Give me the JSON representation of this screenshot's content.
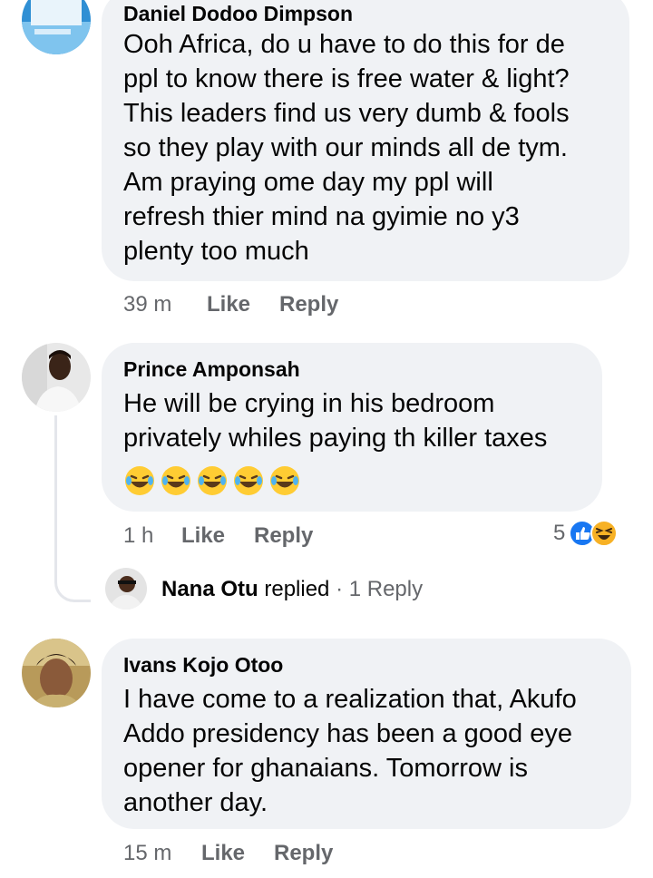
{
  "comments": [
    {
      "author": "Daniel Dodoo Dimpson",
      "lines": [
        "Ooh Africa, do u have to do this for de",
        "ppl to know there is free water & light?",
        "This leaders find us very dumb & fools",
        "so they play with our minds all de tym.",
        "Am praying ome day my ppl will",
        "refresh thier mind na gyimie no y3",
        "plenty too much"
      ],
      "time": "39 m",
      "like": "Like",
      "reply": "Reply"
    },
    {
      "author": "Prince Amponsah",
      "lines": [
        "He will be crying in his bedroom",
        "privately whiles paying th killer taxes"
      ],
      "emoji": [
        "laughing-tears",
        "laughing-tears",
        "laughing-tears",
        "laughing-tears",
        "laughing-tears"
      ],
      "time": "1 h",
      "like": "Like",
      "reply": "Reply",
      "reaction_count": "5",
      "reaction_icons": [
        "like-reaction-icon",
        "haha-reaction-icon"
      ],
      "replies": {
        "name": "Nana Otu",
        "verb": " replied",
        "separator": " · ",
        "count": "1 Reply"
      }
    },
    {
      "author": "Ivans Kojo Otoo",
      "lines": [
        "I have come to a realization that, Akufo",
        "Addo presidency has been a good eye",
        "opener for ghanaians. Tomorrow is",
        "another day."
      ],
      "time": "15 m",
      "like": "Like",
      "reply": "Reply"
    }
  ],
  "colors": {
    "bubble": "#f0f2f5",
    "meta_text": "#65676b",
    "like_blue": "#1877f2",
    "haha_yellow": "#f7b125"
  }
}
